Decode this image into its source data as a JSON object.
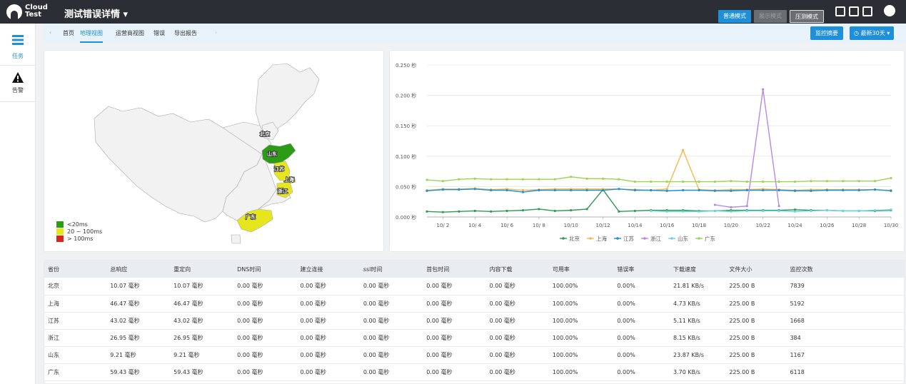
{
  "app": {
    "logo_text": "Cloud Test",
    "page_title": "测试错误详情"
  },
  "modes": [
    "普通模式",
    "展示模式",
    "压测模式"
  ],
  "sidebar": {
    "items": [
      {
        "label": "任务",
        "icon": "list-icon"
      },
      {
        "label": "告警",
        "icon": "warning-icon"
      }
    ]
  },
  "nav": {
    "tabs": [
      "首页",
      "地理视图",
      "运营商视图",
      "错误",
      "导出报告"
    ],
    "active": "地理视图",
    "summary_label": "监控摘要",
    "range_label": "最新30天"
  },
  "map": {
    "labels": [
      "北京",
      "山东",
      "江苏",
      "上海",
      "浙江",
      "广东"
    ],
    "legend": [
      {
        "label": "<20ms",
        "color": "#2e9b16"
      },
      {
        "label": "20 ~ 100ms",
        "color": "#e6e61c"
      },
      {
        "label": "> 100ms",
        "color": "#d4251f"
      }
    ]
  },
  "chart_data": {
    "type": "line",
    "title": "",
    "y_ticks": [
      "0.000 秒",
      "0.050 秒",
      "0.100 秒",
      "0.150 秒",
      "0.200 秒",
      "0.250 秒"
    ],
    "ylim": [
      0,
      0.25
    ],
    "x_ticks": [
      "10/ 2",
      "10/ 4",
      "10/ 6",
      "10/ 8",
      "10/10",
      "10/12",
      "10/14",
      "10/16",
      "10/18",
      "10/20",
      "10/22",
      "10/24",
      "10/26",
      "10/28",
      "10/30"
    ],
    "x": [
      1,
      2,
      3,
      4,
      5,
      6,
      7,
      8,
      9,
      10,
      11,
      12,
      13,
      14,
      15,
      16,
      17,
      18,
      19,
      20,
      21,
      22,
      23,
      24,
      25,
      26,
      27,
      28,
      29,
      30
    ],
    "legend_position": "bottom",
    "series": [
      {
        "name": "北京",
        "color": "#2e9b4f",
        "values": [
          0.009,
          0.008,
          0.009,
          0.01,
          0.009,
          0.01,
          0.011,
          0.013,
          0.01,
          0.011,
          0.013,
          0.045,
          0.009,
          0.01,
          0.011,
          0.011,
          0.011,
          0.01,
          0.01,
          0.011,
          0.011,
          0.011,
          0.011,
          0.012,
          0.011,
          0.011,
          0.01,
          0.01,
          0.01,
          0.011
        ]
      },
      {
        "name": "上海",
        "color": "#f0b94b",
        "values": [
          0.044,
          0.046,
          0.046,
          0.047,
          0.045,
          0.046,
          0.044,
          0.045,
          0.046,
          0.046,
          0.046,
          0.046,
          0.046,
          0.045,
          0.044,
          0.046,
          0.11,
          0.045,
          0.044,
          0.045,
          0.045,
          0.046,
          0.045,
          0.044,
          0.045,
          0.045,
          0.045,
          0.045,
          0.045,
          0.044
        ]
      },
      {
        "name": "江苏",
        "color": "#1e8fd8",
        "values": [
          0.043,
          0.045,
          0.045,
          0.046,
          0.044,
          0.044,
          0.041,
          0.044,
          0.044,
          0.044,
          0.044,
          0.044,
          0.046,
          0.044,
          0.044,
          0.043,
          0.044,
          0.044,
          0.043,
          0.043,
          0.044,
          0.044,
          0.044,
          0.043,
          0.043,
          0.044,
          0.044,
          0.044,
          0.045,
          0.043
        ]
      },
      {
        "name": "浙江",
        "color": "#b48ae8",
        "values": [
          null,
          null,
          null,
          null,
          null,
          null,
          null,
          null,
          null,
          null,
          null,
          null,
          null,
          null,
          null,
          null,
          null,
          null,
          0.02,
          0.016,
          0.018,
          0.21,
          0.018,
          null,
          null,
          null,
          null,
          null,
          null,
          null
        ]
      },
      {
        "name": "山东",
        "color": "#6fd0e2",
        "values": [
          null,
          null,
          null,
          null,
          null,
          null,
          null,
          null,
          null,
          null,
          null,
          null,
          null,
          null,
          0.01,
          0.009,
          0.009,
          0.009,
          0.01,
          0.009,
          0.01,
          0.01,
          0.01,
          0.009,
          0.01,
          0.011,
          0.01,
          0.01,
          0.011,
          0.012
        ]
      },
      {
        "name": "广东",
        "color": "#9ad651",
        "values": [
          0.061,
          0.059,
          0.062,
          0.063,
          0.062,
          0.062,
          0.062,
          0.062,
          0.062,
          0.066,
          0.063,
          0.063,
          0.062,
          0.058,
          0.058,
          0.058,
          0.058,
          0.058,
          0.058,
          0.059,
          0.058,
          0.058,
          0.058,
          0.058,
          0.059,
          0.059,
          0.059,
          0.059,
          0.059,
          0.064
        ]
      }
    ]
  },
  "table": {
    "headers": [
      "省份",
      "总响应",
      "重定向",
      "DNS时间",
      "建立连接",
      "ssl时间",
      "首包时间",
      "内容下载",
      "可用率",
      "错误率",
      "下载速度",
      "文件大小",
      "监控次数"
    ],
    "rows": [
      [
        "北京",
        "10.07 毫秒",
        "10.07 毫秒",
        "0.00 毫秒",
        "0.00 毫秒",
        "0.00 毫秒",
        "0.00 毫秒",
        "0.00 毫秒",
        "100.00%",
        "0.00%",
        "21.81 KB/s",
        "225.00 B",
        "7839"
      ],
      [
        "上海",
        "46.47 毫秒",
        "46.47 毫秒",
        "0.00 毫秒",
        "0.00 毫秒",
        "0.00 毫秒",
        "0.00 毫秒",
        "0.00 毫秒",
        "100.00%",
        "0.00%",
        "4.73 KB/s",
        "225.00 B",
        "5192"
      ],
      [
        "江苏",
        "43.02 毫秒",
        "43.02 毫秒",
        "0.00 毫秒",
        "0.00 毫秒",
        "0.00 毫秒",
        "0.00 毫秒",
        "0.00 毫秒",
        "100.00%",
        "0.00%",
        "5.11 KB/s",
        "225.00 B",
        "1668"
      ],
      [
        "浙江",
        "26.95 毫秒",
        "26.95 毫秒",
        "0.00 毫秒",
        "0.00 毫秒",
        "0.00 毫秒",
        "0.00 毫秒",
        "0.00 毫秒",
        "100.00%",
        "0.00%",
        "8.15 KB/s",
        "225.00 B",
        "384"
      ],
      [
        "山东",
        "9.21 毫秒",
        "9.21 毫秒",
        "0.00 毫秒",
        "0.00 毫秒",
        "0.00 毫秒",
        "0.00 毫秒",
        "0.00 毫秒",
        "100.00%",
        "0.00%",
        "23.87 KB/s",
        "225.00 B",
        "1167"
      ],
      [
        "广东",
        "59.43 毫秒",
        "59.43 毫秒",
        "0.00 毫秒",
        "0.00 毫秒",
        "0.00 毫秒",
        "0.00 毫秒",
        "0.00 毫秒",
        "100.00%",
        "0.00%",
        "3.70 KB/s",
        "225.00 B",
        "6118"
      ]
    ]
  }
}
